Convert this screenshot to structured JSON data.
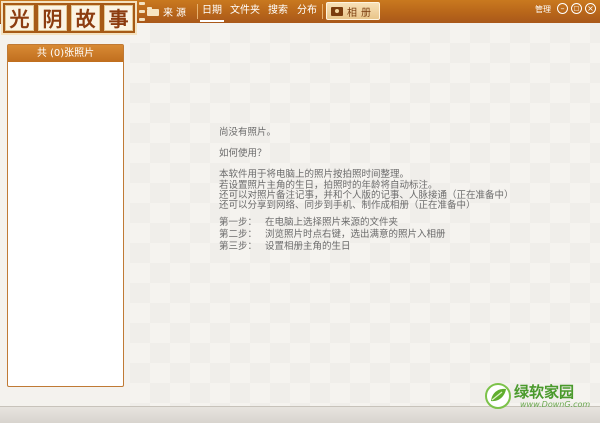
{
  "app": {
    "logo_chars": [
      "光",
      "阴",
      "故",
      "事"
    ]
  },
  "toolbar": {
    "source_label": "来源",
    "tabs": [
      {
        "label": "日期",
        "active": true
      },
      {
        "label": "文件夹",
        "active": false
      },
      {
        "label": "搜索",
        "active": false
      },
      {
        "label": "分布",
        "active": false
      }
    ],
    "album_label": "相册",
    "manage_label": "管理",
    "window_buttons": {
      "minimize": "–",
      "maximize": "□",
      "close": "×"
    }
  },
  "sidebar": {
    "header": "共 (0)张照片"
  },
  "main": {
    "no_photos": "尚没有照片。",
    "how_to_use": "如何使用？",
    "intro_lines": [
      "本软件用于将电脑上的照片按拍照时间整理。",
      "若设置照片主角的生日，拍照时的年龄将自动标注。",
      "还可以对照片备注记事，并和个人版的记事、人脉接通（正在准备中）",
      "还可以分享到网络、同步到手机、制作成相册（正在准备中）"
    ],
    "steps": [
      {
        "label": "第一步：",
        "text": "在电脑上选择照片来源的文件夹"
      },
      {
        "label": "第二步：",
        "text": "浏览照片时点右键，选出满意的照片入相册"
      },
      {
        "label": "第三步：",
        "text": "设置相册主角的生日"
      }
    ]
  },
  "watermark": {
    "title": "绿软家园",
    "url": "www.DownG.com"
  },
  "colors": {
    "toolbar": "#b8661a",
    "logo_text": "#8c3c10",
    "watermark": "#4a9a2c"
  }
}
